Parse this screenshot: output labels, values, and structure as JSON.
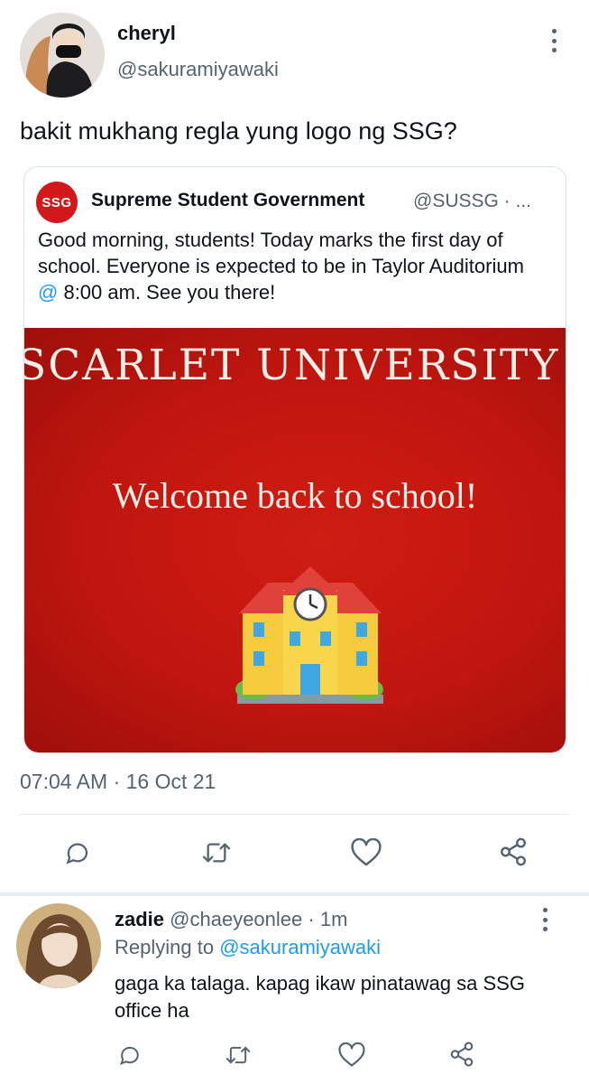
{
  "tweet": {
    "display_name": "cheryl",
    "handle": "@sakuramiyawaki",
    "text": "bakit mukhang regla yung logo ng SSG?",
    "timestamp": "07:04 AM · 16 Oct 21",
    "more_icon": "more-vertical-icon"
  },
  "quoted": {
    "logo_text": "SSG",
    "display_name": "Supreme Student Government",
    "handle": "@SUSSG · ...",
    "text_before": "Good morning, students! Today marks the first day of school. Everyone is expected to be in Taylor Auditorium ",
    "mention": "@",
    "text_after": " 8:00 am. See you there!",
    "image": {
      "headline": "SCARLET UNIVERSITY",
      "subline": "Welcome back to school!",
      "emoji": "school-building-icon",
      "bg_color": "#c0160f"
    }
  },
  "actions": [
    "reply-icon",
    "retweet-icon",
    "like-icon",
    "share-icon"
  ],
  "reply": {
    "display_name": "zadie",
    "handle": "@chaeyeonlee",
    "time": "· 1m",
    "replying_prefix": "Replying to",
    "replying_to": "@sakuramiyawaki",
    "text": "gaga ka talaga. kapag ikaw pinatawag sa SSG office ha"
  },
  "colors": {
    "accent": "#1d9bf0",
    "secondary_text": "#536471",
    "image_red": "#c0160f"
  }
}
